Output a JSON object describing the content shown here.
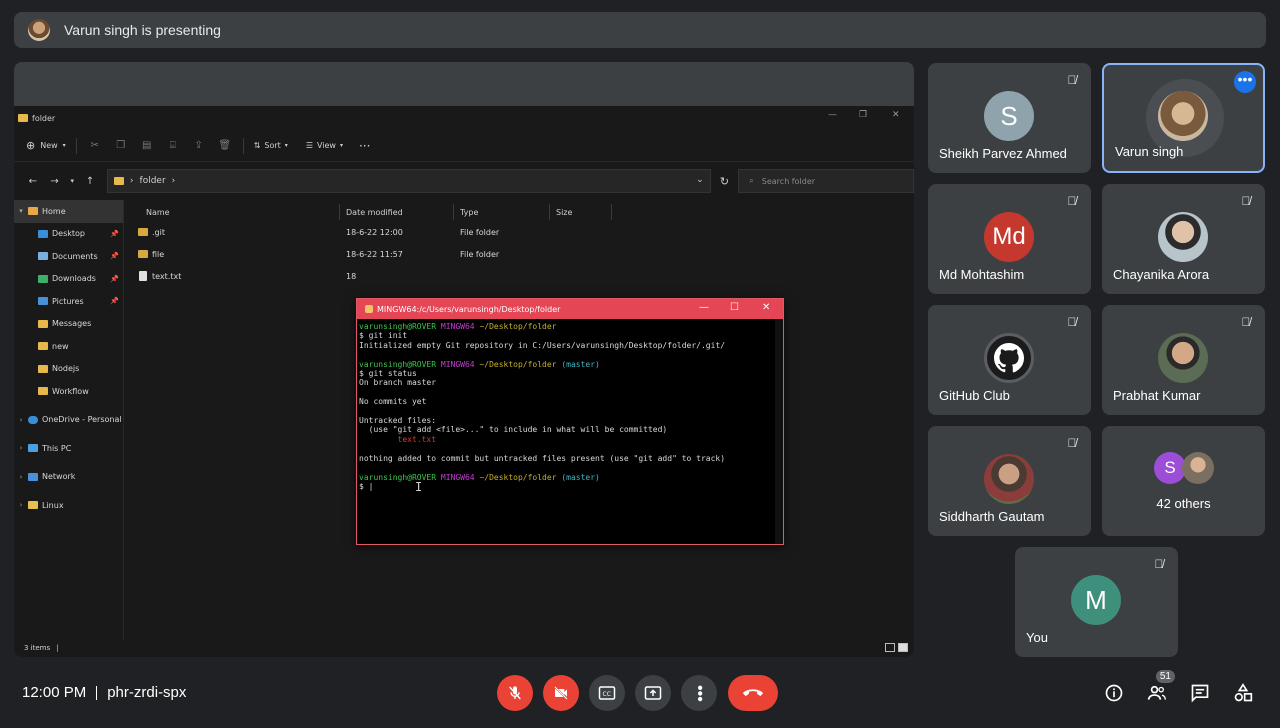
{
  "banner": {
    "text": "Varun singh is presenting"
  },
  "explorer": {
    "title": "folder",
    "toolbar": {
      "new": "New",
      "sort": "Sort",
      "view": "View"
    },
    "address": "folder",
    "search_placeholder": "Search folder",
    "sidebar": [
      {
        "label": "Home",
        "icon": "home-icon"
      },
      {
        "label": "Desktop",
        "icon": "desktop-icon",
        "pinned": true
      },
      {
        "label": "Documents",
        "icon": "documents-icon",
        "pinned": true
      },
      {
        "label": "Downloads",
        "icon": "download-icon",
        "pinned": true
      },
      {
        "label": "Pictures",
        "icon": "pictures-icon",
        "pinned": true
      },
      {
        "label": "Messages",
        "icon": "folder-icon"
      },
      {
        "label": "new",
        "icon": "folder-icon"
      },
      {
        "label": "Nodejs",
        "icon": "folder-icon"
      },
      {
        "label": "Workflow",
        "icon": "folder-icon"
      },
      {
        "label": "OneDrive - Personal",
        "icon": "cloud-icon"
      },
      {
        "label": "This PC",
        "icon": "pc-icon"
      },
      {
        "label": "Network",
        "icon": "network-icon"
      },
      {
        "label": "Linux",
        "icon": "linux-icon"
      }
    ],
    "columns": {
      "name": "Name",
      "date": "Date modified",
      "type": "Type",
      "size": "Size"
    },
    "files": [
      {
        "name": ".git",
        "date": "18-6-22 12:00",
        "type": "File folder"
      },
      {
        "name": "file",
        "date": "18-6-22 11:57",
        "type": "File folder"
      },
      {
        "name": "text.txt",
        "date": "18",
        "type": ""
      }
    ],
    "status": "3 items"
  },
  "terminal": {
    "title": "MINGW64:/c/Users/varunsingh/Desktop/folder",
    "lines": {
      "p1_user": "varunsingh@ROVER",
      "p1_env": "MINGW64",
      "p1_path": "~/Desktop/folder",
      "cmd1": "$ git init",
      "out1": "Initialized empty Git repository in C:/Users/varunsingh/Desktop/folder/.git/",
      "p2_user": "varunsingh@ROVER",
      "p2_env": "MINGW64",
      "p2_path": "~/Desktop/folder",
      "p2_branch": "(master)",
      "cmd2": "$ git status",
      "out2a": "On branch master",
      "out2b": "No commits yet",
      "out2c": "Untracked files:",
      "out2d": "  (use \"git add <file>...\" to include in what will be committed)",
      "out2e": "        text.txt",
      "out2f": "nothing added to commit but untracked files present (use \"git add\" to track)",
      "p3_user": "varunsingh@ROVER",
      "p3_env": "MINGW64",
      "p3_path": "~/Desktop/folder",
      "p3_branch": "(master)",
      "cmd3": "$ |"
    }
  },
  "participants": [
    {
      "name": "Sheikh Parvez Ahmed",
      "initial": "S",
      "color": "#8fa3ad"
    },
    {
      "name": "Varun singh",
      "initial": "",
      "color": "#7a5a3c"
    },
    {
      "name": "Md Mohtashim",
      "initial": "Md",
      "color": "#c5382e"
    },
    {
      "name": "Chayanika Arora",
      "initial": "",
      "color": "#b7c4c9"
    },
    {
      "name": "GitHub Club",
      "initial": "",
      "color": "#ffffff"
    },
    {
      "name": "Prabhat Kumar",
      "initial": "",
      "color": "#5c6b54"
    },
    {
      "name": "Siddharth Gautam",
      "initial": "",
      "color": "#6d4c3f"
    },
    {
      "name": "You",
      "initial": "M",
      "color": "#3e8f7c"
    }
  ],
  "others": {
    "label": "42 others",
    "initial": "S",
    "color": "#9c4fd6"
  },
  "bottom": {
    "time": "12:00 PM",
    "code": "phr-zrdi-spx",
    "people_count": "51"
  }
}
